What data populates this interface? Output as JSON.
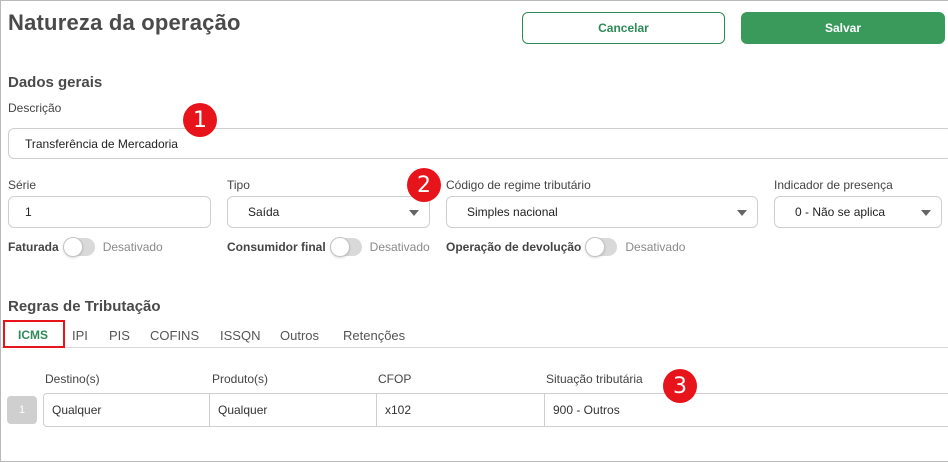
{
  "page": {
    "title": "Natureza da operação"
  },
  "actions": {
    "cancel_label": "Cancelar",
    "save_label": "Salvar"
  },
  "general": {
    "section_title": "Dados gerais",
    "descricao_label": "Descrição",
    "descricao_value": "Transferência de Mercadoria",
    "serie_label": "Série",
    "serie_value": "1",
    "tipo_label": "Tipo",
    "tipo_value": "Saída",
    "regime_label": "Código de regime tributário",
    "regime_value": "Simples nacional",
    "presenca_label": "Indicador de presença",
    "presenca_value": "0 - Não se aplica"
  },
  "toggles": [
    {
      "label": "Faturada",
      "state": "Desativado"
    },
    {
      "label": "Consumidor final",
      "state": "Desativado"
    },
    {
      "label": "Operação de devolução",
      "state": "Desativado"
    }
  ],
  "annotations": [
    "1",
    "2",
    "3"
  ],
  "taxation": {
    "section_title": "Regras de Tributação",
    "tabs": [
      "ICMS",
      "IPI",
      "PIS",
      "COFINS",
      "ISSQN",
      "Outros",
      "Retenções"
    ],
    "active_tab": "ICMS",
    "columns": [
      "Destino(s)",
      "Produto(s)",
      "CFOP",
      "Situação tributária"
    ],
    "rows": [
      {
        "index": "1",
        "destino": "Qualquer",
        "produto": "Qualquer",
        "cfop": "x102",
        "situacao": "900 - Outros"
      }
    ]
  },
  "colors": {
    "accent": "#3a9a5c",
    "annotation": "#e8141c"
  }
}
